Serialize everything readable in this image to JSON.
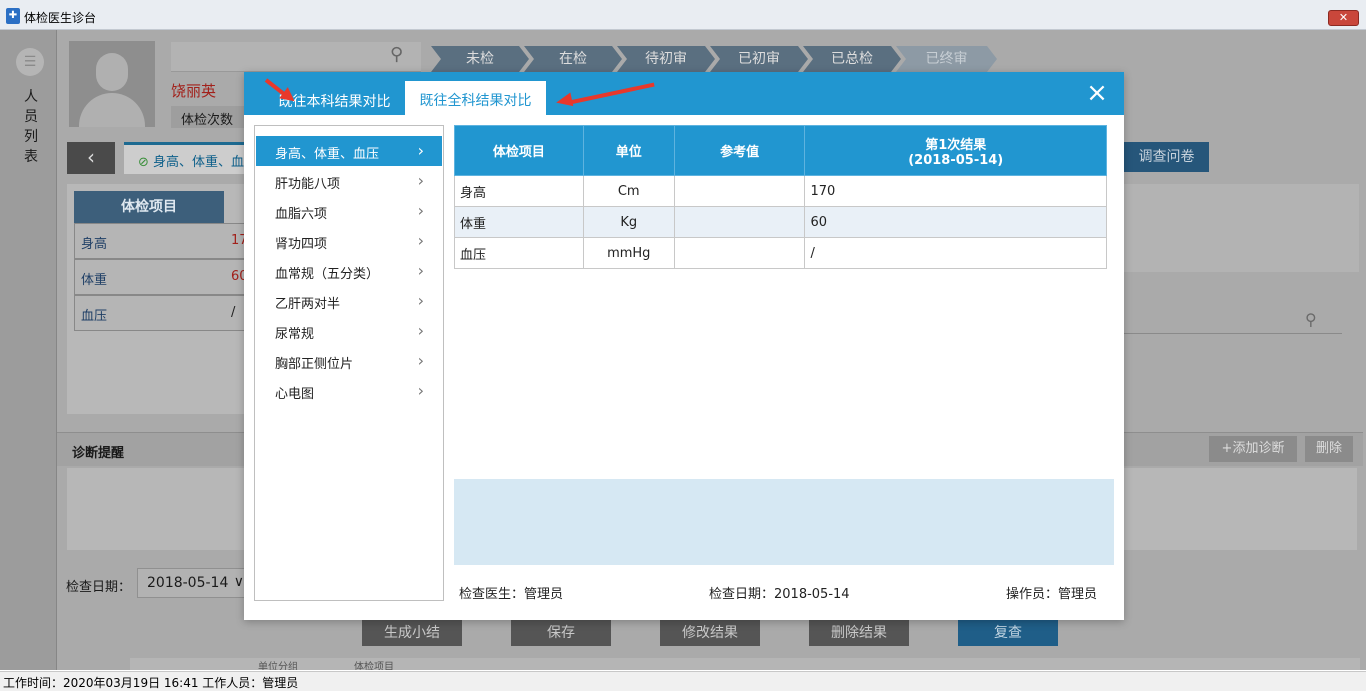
{
  "window": {
    "title": "体检医生诊台",
    "close_label": "✕"
  },
  "side": {
    "chars": [
      "人",
      "员",
      "列",
      "表"
    ]
  },
  "patient": {
    "name": "饶丽英",
    "exam_count_label": "体检次数"
  },
  "steps": [
    "未检",
    "在检",
    "待初审",
    "已初审",
    "已总检",
    "已终审"
  ],
  "prev_tab": "身高、体重、血压",
  "bg_table": {
    "header": "体检项目",
    "rows": [
      {
        "item": "身高",
        "value": "17"
      },
      {
        "item": "体重",
        "value": "60"
      },
      {
        "item": "血压",
        "value": "/"
      }
    ]
  },
  "survey_button": "调查问卷",
  "diagnosis": {
    "title": "诊断提醒",
    "add_label": "+添加诊断",
    "delete_label": "删除"
  },
  "date": {
    "label": "检查日期：",
    "value": "2018-05-14"
  },
  "bottom_buttons": [
    "生成小结",
    "保存",
    "修改结果",
    "删除结果",
    "复查"
  ],
  "hidden_row": [
    "单位分组",
    "体检项目"
  ],
  "status": "工作时间：2020年03月19日 16:41  工作人员：管理员",
  "modal": {
    "tabs": [
      "既往本科结果对比",
      "既往全科结果对比"
    ],
    "active_tab": 1,
    "close_icon": "×",
    "categories": [
      "身高、体重、血压",
      "肝功能八项",
      "血脂六项",
      "肾功四项",
      "血常规（五分类）",
      "乙肝两对半",
      "尿常规",
      "胸部正侧位片",
      "心电图"
    ],
    "table": {
      "headers": [
        "体检项目",
        "单位",
        "参考值",
        "第1次结果",
        "(2018-05-14)"
      ],
      "rows": [
        {
          "item": "身高",
          "unit": "Cm",
          "ref": "",
          "result": "170"
        },
        {
          "item": "体重",
          "unit": "Kg",
          "ref": "",
          "result": "60"
        },
        {
          "item": "血压",
          "unit": "mmHg",
          "ref": "",
          "result": "/"
        }
      ]
    },
    "footer": {
      "doctor": "检查医生：管理员",
      "date": "检查日期：2018-05-14",
      "operator": "操作员：管理员"
    }
  },
  "colors": {
    "accent": "#2196d0",
    "annotation_arrow": "#e8382b",
    "patient_name": "#a2211b"
  }
}
